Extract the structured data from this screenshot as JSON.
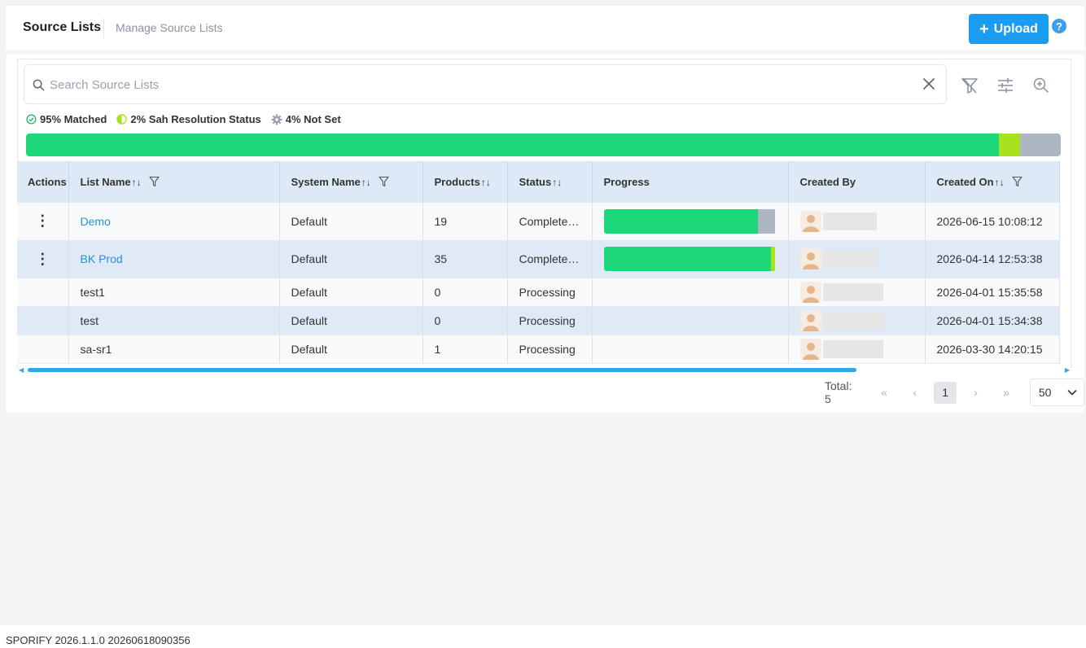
{
  "header": {
    "title": "Source Lists",
    "subtitle": "Manage Source Lists",
    "upload_label": "Upload",
    "help_label": "?"
  },
  "search": {
    "placeholder": "Search Source Lists"
  },
  "summary": {
    "matched": "95% Matched",
    "resolution": "2% Sah Resolution Status",
    "not_set": "4% Not Set",
    "bar": {
      "matched": 95,
      "resolution": 2,
      "not_set": 4
    },
    "colors": {
      "matched": "#1cd87b",
      "resolution": "#a8e21f",
      "not_set": "#adb7c4"
    }
  },
  "table": {
    "headers": {
      "actions": "Actions",
      "list_name": "List Name",
      "system_name": "System Name",
      "products": "Products",
      "status": "Status",
      "progress": "Progress",
      "created_by": "Created By",
      "created_on": "Created On"
    },
    "rows": [
      {
        "name": "Demo",
        "system": "Default",
        "products": "19",
        "status": "Complete…",
        "created_on": "2026-06-15 10:08:12",
        "progress": {
          "green": 0.9,
          "lime": 0,
          "gray": 0.1
        }
      },
      {
        "name": "BK Prod",
        "system": "Default",
        "products": "35",
        "status": "Complete…",
        "created_on": "2026-04-14 12:53:38",
        "progress": {
          "green": 0.975,
          "lime": 0.025,
          "gray": 0
        }
      },
      {
        "name": "test1",
        "system": "Default",
        "products": "0",
        "status": "Processing",
        "created_on": "2026-04-01 15:35:58"
      },
      {
        "name": "test",
        "system": "Default",
        "products": "0",
        "status": "Processing",
        "created_on": "2026-04-01 15:34:38"
      },
      {
        "name": "sa-sr1",
        "system": "Default",
        "products": "1",
        "status": "Processing",
        "created_on": "2026-03-30 14:20:15"
      }
    ]
  },
  "pagination": {
    "total": "Total: 5",
    "first": "«",
    "prev": "‹",
    "current": "1",
    "next": "›",
    "last": "»",
    "page_size": "50"
  },
  "footer": {
    "version": "SPORIFY 2026.1.1.0 20260618090356"
  },
  "icons": {
    "search": "search-icon",
    "clear": "close-icon",
    "filter_clear": "filter-off-icon",
    "settings": "sliders-icon",
    "zoom": "zoom-in-icon",
    "kebab": "more-vertical-icon",
    "sort": "sort-icon",
    "filter": "filter-icon",
    "avatar": "user-avatar-icon",
    "matched": "check-circle-icon",
    "resolution": "half-circle-icon",
    "not_set": "gear-icon"
  }
}
